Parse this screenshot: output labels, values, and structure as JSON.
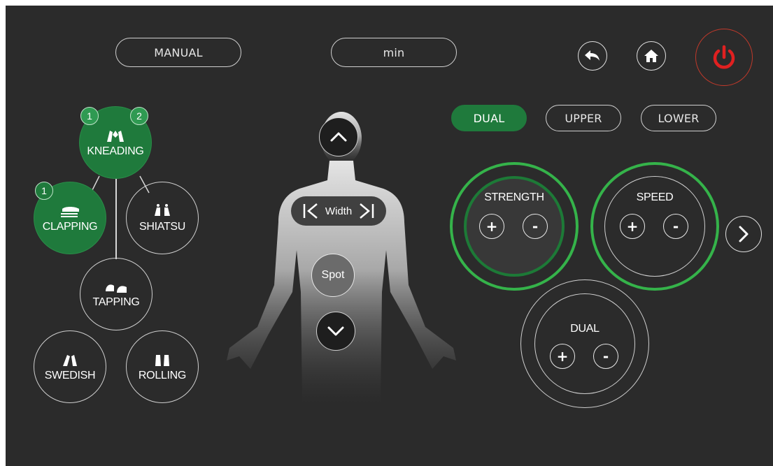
{
  "top_bar": {
    "mode_label": "MANUAL",
    "time_label": "min",
    "back_icon": "undo-arrow-icon",
    "home_icon": "home-icon",
    "power_icon": "power-icon",
    "power_color": "#e02020"
  },
  "techniques": {
    "items": [
      {
        "label": "KNEADING",
        "icon": "kneading-hands-icon",
        "active": true,
        "badges": [
          "1",
          "2"
        ]
      },
      {
        "label": "CLAPPING",
        "icon": "clapping-hand-icon",
        "active": true,
        "badges": [
          "1"
        ]
      },
      {
        "label": "SHIATSU",
        "icon": "shiatsu-hands-icon",
        "active": false
      },
      {
        "label": "TAPPING",
        "icon": "tapping-hands-icon",
        "active": false
      },
      {
        "label": "SWEDISH",
        "icon": "swedish-hand-icon",
        "active": false
      },
      {
        "label": "ROLLING",
        "icon": "rolling-hands-icon",
        "active": false
      }
    ]
  },
  "body_panel": {
    "width_label": "Width",
    "spot_label": "Spot",
    "up_icon": "chevron-up-icon",
    "down_icon": "chevron-down-icon"
  },
  "zone_tabs": [
    {
      "label": "DUAL",
      "active": true
    },
    {
      "label": "UPPER",
      "active": false
    },
    {
      "label": "LOWER",
      "active": false
    }
  ],
  "controls": {
    "strength": {
      "label": "STRENGTH",
      "plus": "+",
      "minus": "-"
    },
    "speed": {
      "label": "SPEED",
      "plus": "+",
      "minus": "-"
    },
    "dual": {
      "label": "DUAL",
      "plus": "+",
      "minus": "-"
    },
    "next_icon": "chevron-right-icon"
  },
  "colors": {
    "background": "#2b2b2b",
    "accent_green": "#1f7a3c",
    "ring_green": "#33b24a",
    "power_red": "#e02020"
  }
}
